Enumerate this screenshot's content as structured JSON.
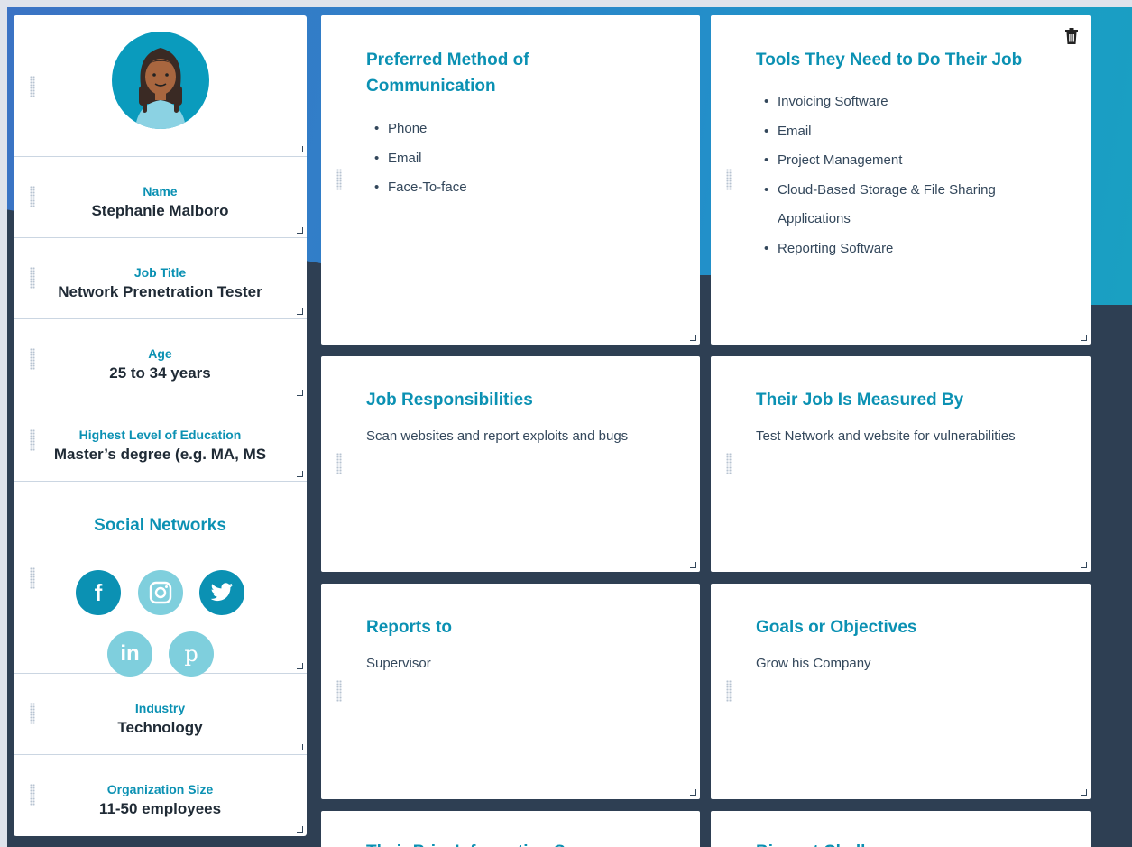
{
  "profile": {
    "fields": [
      {
        "label": "Name",
        "value": "Stephanie Malboro"
      },
      {
        "label": "Job Title",
        "value": "Network Prenetration Tester"
      },
      {
        "label": "Age",
        "value": "25 to 34 years"
      },
      {
        "label": "Highest Level of Education",
        "value": "Master’s degree (e.g. MA, MS"
      }
    ],
    "social": {
      "title": "Social Networks",
      "networks": [
        {
          "name": "facebook-icon",
          "glyph": "f"
        },
        {
          "name": "instagram-icon",
          "glyph": ""
        },
        {
          "name": "twitter-icon",
          "glyph": ""
        },
        {
          "name": "linkedin-icon",
          "glyph": "in"
        },
        {
          "name": "pinterest-icon",
          "glyph": "p"
        }
      ]
    },
    "fields_bottom": [
      {
        "label": "Industry",
        "value": "Technology"
      },
      {
        "label": "Organization Size",
        "value": "11-50 employees"
      }
    ]
  },
  "cards": {
    "communication": {
      "title": "Preferred Method of Communication",
      "items": [
        "Phone",
        "Email",
        "Face-To-face"
      ]
    },
    "tools": {
      "title": "Tools They Need to Do Their Job",
      "items": [
        "Invoicing Software",
        "Email",
        "Project Management",
        "Cloud-Based Storage & File Sharing Applications",
        "Reporting Software"
      ]
    },
    "responsibilities": {
      "title": "Job Responsibilities",
      "text": "Scan websites and report exploits and bugs"
    },
    "measured": {
      "title": "Their Job Is Measured By",
      "text": "Test Network and website for vulnerabilities"
    },
    "reports": {
      "title": "Reports to",
      "text": "Supervisor"
    },
    "goals": {
      "title": "Goals or Objectives",
      "text": "Grow his Company"
    },
    "partial_left": {
      "title": "Their Pri... Information Sources"
    },
    "partial_right": {
      "title": "Biggest Challenges"
    }
  },
  "colors": {
    "accent": "#0b91b3",
    "light_accent": "#7fcfdd",
    "background": "#2e3f53",
    "banner": "#2e82c9"
  }
}
